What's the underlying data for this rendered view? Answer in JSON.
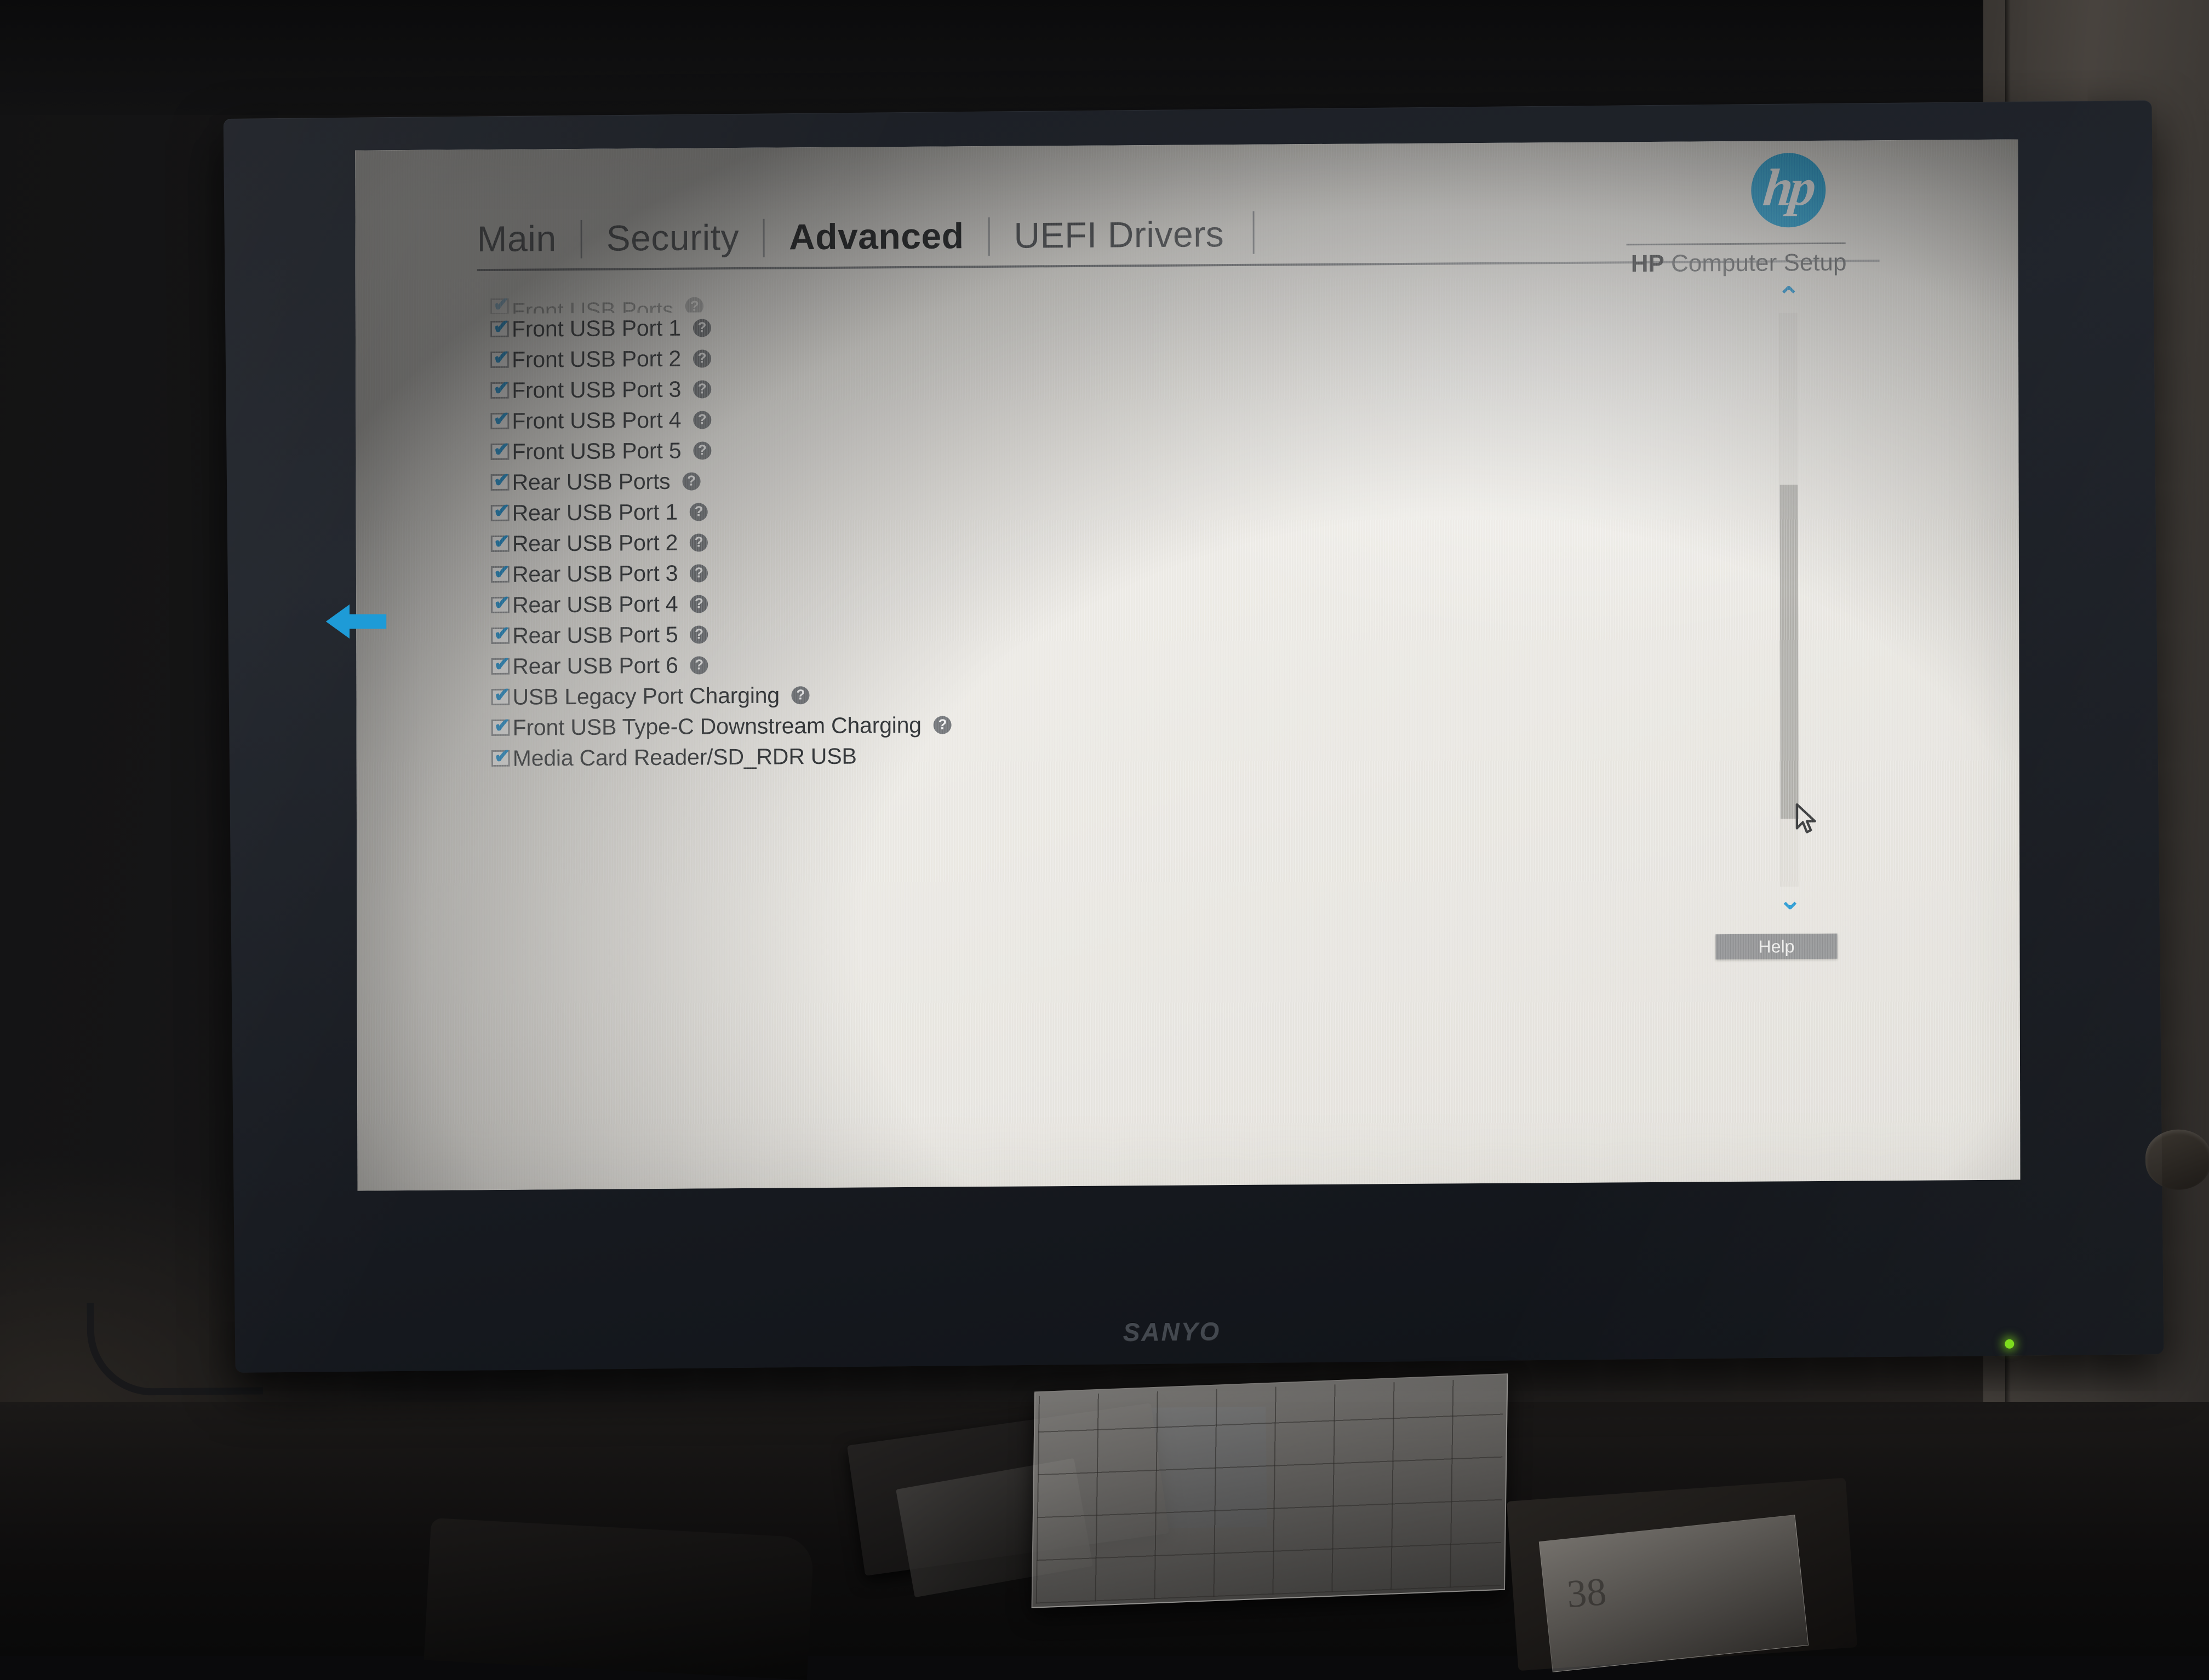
{
  "device": {
    "monitor_brand": "SANYO",
    "accent_blue": "#1797d4",
    "screen_bg": "#eceae5"
  },
  "header": {
    "tabs": [
      {
        "label": "Main",
        "active": false
      },
      {
        "label": "Security",
        "active": false
      },
      {
        "label": "Advanced",
        "active": true
      },
      {
        "label": "UEFI Drivers",
        "active": false
      }
    ],
    "logo_text": "hp",
    "brand_bold": "HP",
    "brand_rest": " Computer Setup"
  },
  "settings_list": {
    "clipped_top_row": {
      "label": "Front USB Ports",
      "checked": true,
      "has_help": true
    },
    "items": [
      {
        "label": "Front USB Port 1",
        "checked": true,
        "has_help": true
      },
      {
        "label": "Front USB Port 2",
        "checked": true,
        "has_help": true
      },
      {
        "label": "Front USB Port 3",
        "checked": true,
        "has_help": true
      },
      {
        "label": "Front USB Port 4",
        "checked": true,
        "has_help": true
      },
      {
        "label": "Front USB Port 5",
        "checked": true,
        "has_help": true
      },
      {
        "label": "Rear USB Ports",
        "checked": true,
        "has_help": true
      },
      {
        "label": "Rear USB Port 1",
        "checked": true,
        "has_help": true
      },
      {
        "label": "Rear USB Port 2",
        "checked": true,
        "has_help": true
      },
      {
        "label": "Rear USB Port 3",
        "checked": true,
        "has_help": true
      },
      {
        "label": "Rear USB Port 4",
        "checked": true,
        "has_help": true
      },
      {
        "label": "Rear USB Port 5",
        "checked": true,
        "has_help": true
      },
      {
        "label": "Rear USB Port 6",
        "checked": true,
        "has_help": true
      },
      {
        "label": "USB Legacy Port Charging",
        "checked": true,
        "has_help": true
      },
      {
        "label": "Front USB Type-C Downstream Charging",
        "checked": true,
        "has_help": true
      },
      {
        "label": "Media Card Reader/SD_RDR USB",
        "checked": true,
        "has_help": false
      }
    ],
    "checkmark_glyph": "✔",
    "help_glyph": "?"
  },
  "scrollbar": {
    "up_glyph": "⌃",
    "down_glyph": "⌄"
  },
  "footer": {
    "help_button": "Help"
  },
  "annotation": {
    "arrow_color": "#1e9bd7",
    "direction": "left"
  },
  "desk": {
    "note_scrawl": "38"
  }
}
